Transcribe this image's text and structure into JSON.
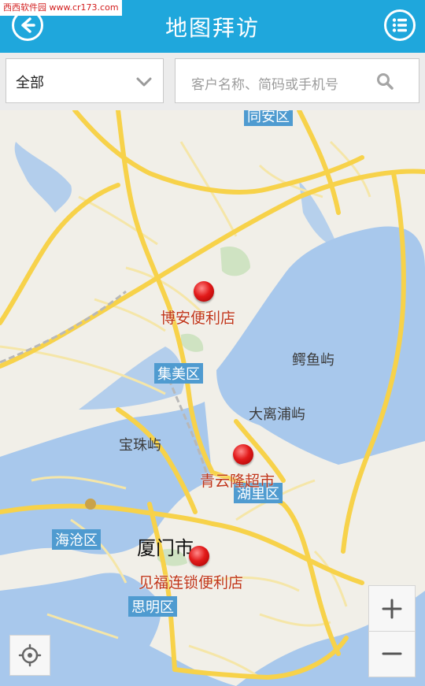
{
  "watermark": "西西软件园 www.cr173.com",
  "header": {
    "title": "地图拜访",
    "back_icon": "back-arrow-icon",
    "menu_icon": "list-menu-icon"
  },
  "filter": {
    "category_value": "全部",
    "search_placeholder": "客户名称、简码或手机号"
  },
  "map": {
    "place_labels": [
      {
        "id": "tongan",
        "text": "同安区"
      },
      {
        "id": "jimei",
        "text": "集美区"
      },
      {
        "id": "eyuyu",
        "text": "鳄鱼屿"
      },
      {
        "id": "dalipu",
        "text": "大离浦屿"
      },
      {
        "id": "baozhuyu",
        "text": "宝珠屿"
      },
      {
        "id": "huli",
        "text": "湖里区"
      },
      {
        "id": "haicang",
        "text": "海沧区"
      },
      {
        "id": "xiamen",
        "text": "厦门市"
      },
      {
        "id": "siming",
        "text": "思明区"
      }
    ],
    "markers": [
      {
        "name": "博安便利店"
      },
      {
        "name": "青云隆超市"
      },
      {
        "name": "见福连锁便利店"
      }
    ]
  },
  "controls": {
    "zoom_in": "+",
    "zoom_out": "−"
  },
  "colors": {
    "header": "#1fa7dc",
    "water": "#a8c8ec",
    "land": "#f1efe8",
    "road": "#f7d24a",
    "marker": "#e21a1a"
  }
}
